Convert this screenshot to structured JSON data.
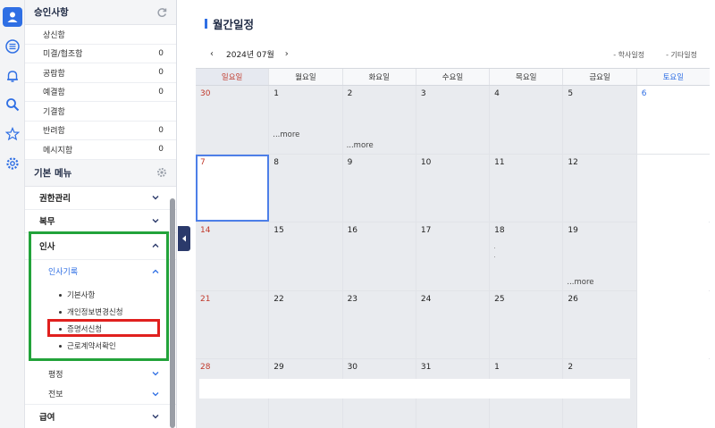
{
  "rail": {
    "items": [
      {
        "icon": "user-icon",
        "active": true
      },
      {
        "icon": "list-icon",
        "active": false
      },
      {
        "icon": "bell-icon",
        "active": false
      },
      {
        "icon": "search-icon",
        "active": false
      },
      {
        "icon": "star-icon",
        "active": false
      },
      {
        "icon": "gear-icon",
        "active": false
      }
    ]
  },
  "approval": {
    "title": "승인사항",
    "rows": [
      {
        "label": "상신함",
        "count": ""
      },
      {
        "label": "미결/협조함",
        "count": "0"
      },
      {
        "label": "공람함",
        "count": "0"
      },
      {
        "label": "예결함",
        "count": "0"
      },
      {
        "label": "기결함",
        "count": ""
      },
      {
        "label": "반려함",
        "count": "0"
      },
      {
        "label": "메시지함",
        "count": "0"
      }
    ]
  },
  "menu": {
    "title": "기본 메뉴",
    "items": {
      "auth": "권한관리",
      "service": "복무",
      "hr": "인사",
      "hr_record": "인사기록",
      "leaf_basic": "기본사항",
      "leaf_privacy": "개인정보변경신청",
      "leaf_cert": "증명서신청",
      "leaf_contract": "근로계약서확인",
      "eval": "평정",
      "transfer": "전보",
      "pay": "급여"
    }
  },
  "calendar": {
    "title": "월간일정",
    "month_label": "2024년 07월",
    "legend": [
      "- 학사일정",
      "- 기타일정"
    ],
    "weekdays": [
      "일요일",
      "월요일",
      "화요일",
      "수요일",
      "목요일",
      "금요일",
      "토요일"
    ],
    "more_label": "...more",
    "weeks": [
      [
        "30",
        "1",
        "2",
        "3",
        "4",
        "5",
        "6"
      ],
      [
        "7",
        "8",
        "9",
        "10",
        "11",
        "12",
        ""
      ],
      [
        "14",
        "15",
        "16",
        "17",
        "18",
        "19",
        ""
      ],
      [
        "21",
        "22",
        "23",
        "24",
        "25",
        "26",
        ""
      ],
      [
        "28",
        "29",
        "30",
        "31",
        "1",
        "2",
        ""
      ]
    ]
  },
  "colors": {
    "accent": "#2f6fe4",
    "green_highlight": "#22a33a",
    "red_highlight": "#e0201e",
    "sunday": "#c0392b"
  }
}
